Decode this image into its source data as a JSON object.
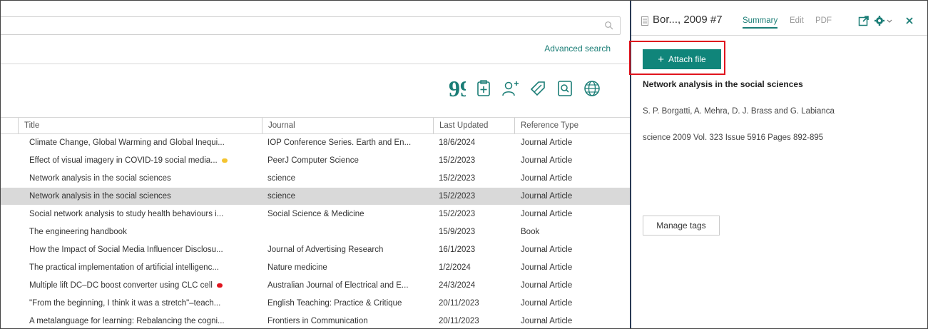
{
  "search": {
    "placeholder": "",
    "advanced_label": "Advanced search"
  },
  "toolbar": {
    "icons": [
      "quote-icon",
      "clipboard-add-icon",
      "add-person-icon",
      "share-icon",
      "find-fulltext-icon",
      "web-icon"
    ]
  },
  "table": {
    "columns": [
      "Title",
      "Journal",
      "Last Updated",
      "Reference Type"
    ],
    "rows": [
      {
        "title": "Climate Change, Global Warming and Global Inequi...",
        "journal": "IOP Conference Series. Earth and En...",
        "updated": "18/6/2024",
        "type": "Journal Article",
        "selected": false,
        "dot": ""
      },
      {
        "title": "Effect of visual imagery in COVID-19 social media...",
        "journal": "PeerJ Computer Science",
        "updated": "15/2/2023",
        "type": "Journal Article",
        "selected": false,
        "dot": "#f4c430"
      },
      {
        "title": "Network analysis in the social sciences",
        "journal": "science",
        "updated": "15/2/2023",
        "type": "Journal Article",
        "selected": false,
        "dot": ""
      },
      {
        "title": "Network analysis in the social sciences",
        "journal": "science",
        "updated": "15/2/2023",
        "type": "Journal Article",
        "selected": true,
        "dot": ""
      },
      {
        "title": "Social network analysis to study health behaviours i...",
        "journal": "Social Science & Medicine",
        "updated": "15/2/2023",
        "type": "Journal Article",
        "selected": false,
        "dot": ""
      },
      {
        "title": "The engineering handbook",
        "journal": "",
        "updated": "15/9/2023",
        "type": "Book",
        "selected": false,
        "dot": ""
      },
      {
        "title": "How the Impact of Social Media Influencer Disclosu...",
        "journal": "Journal of Advertising Research",
        "updated": "16/1/2023",
        "type": "Journal Article",
        "selected": false,
        "dot": ""
      },
      {
        "title": "The practical implementation of artificial intelligenc...",
        "journal": "Nature medicine",
        "updated": "1/2/2024",
        "type": "Journal Article",
        "selected": false,
        "dot": ""
      },
      {
        "title": "Multiple lift DC–DC boost converter using CLC cell",
        "journal": "Australian Journal of Electrical and E...",
        "updated": "24/3/2024",
        "type": "Journal Article",
        "selected": false,
        "dot": "#e0141e"
      },
      {
        "title": "\"From the beginning, I think it was a stretch\"–teach...",
        "journal": "English Teaching: Practice & Critique",
        "updated": "20/11/2023",
        "type": "Journal Article",
        "selected": false,
        "dot": ""
      },
      {
        "title": "A metalanguage for learning: Rebalancing the cogni...",
        "journal": "Frontiers in Communication",
        "updated": "20/11/2023",
        "type": "Journal Article",
        "selected": false,
        "dot": ""
      }
    ]
  },
  "panel": {
    "header_title": "Bor..., 2009 #7",
    "tabs": {
      "summary": "Summary",
      "edit": "Edit",
      "pdf": "PDF"
    },
    "attach_label": "Attach file",
    "ref_title": "Network analysis in the social sciences",
    "authors": "S. P. Borgatti, A. Mehra, D. J. Brass and G. Labianca",
    "source": "science 2009 Vol. 323 Issue 5916 Pages 892-895",
    "manage_tags_label": "Manage tags"
  },
  "colors": {
    "accent": "#1a7d76",
    "attach_bg": "#10857a",
    "highlight": "#e0141e",
    "selected_row": "#d9d9d9",
    "yellow_tag": "#f4c430",
    "red_tag": "#e0141e"
  }
}
